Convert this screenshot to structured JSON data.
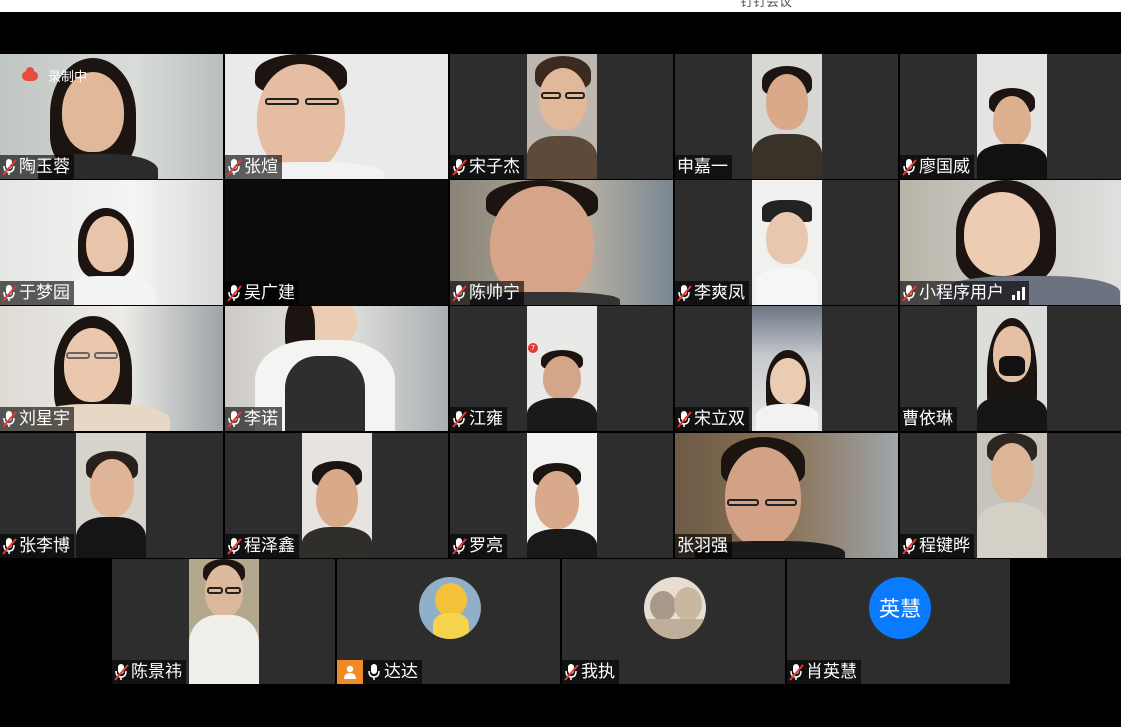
{
  "window": {
    "top_text": "钉钉会议"
  },
  "recording": {
    "label": "录制中"
  },
  "participants": [
    {
      "name": "陶玉蓉",
      "muted": true
    },
    {
      "name": "张煊",
      "muted": true
    },
    {
      "name": "宋子杰",
      "muted": true
    },
    {
      "name": "申嘉一",
      "muted": false
    },
    {
      "name": "廖国威",
      "muted": true
    },
    {
      "name": "于梦园",
      "muted": true
    },
    {
      "name": "吴广建",
      "muted": true
    },
    {
      "name": "陈帅宁",
      "muted": true
    },
    {
      "name": "李爽凤",
      "muted": true
    },
    {
      "name": "小程序用户",
      "muted": true
    },
    {
      "name": "刘星宇",
      "muted": true
    },
    {
      "name": "李诺",
      "muted": true
    },
    {
      "name": "江雍",
      "muted": true
    },
    {
      "name": "宋立双",
      "muted": true
    },
    {
      "name": "曹依琳",
      "muted": false
    },
    {
      "name": "张李博",
      "muted": true
    },
    {
      "name": "程泽鑫",
      "muted": true
    },
    {
      "name": "罗亮",
      "muted": true
    },
    {
      "name": "张羽强",
      "muted": false
    },
    {
      "name": "程键晔",
      "muted": true
    },
    {
      "name": "陈景祎",
      "muted": true
    },
    {
      "name": "达达",
      "muted": false,
      "host": true
    },
    {
      "name": "我执",
      "muted": true
    },
    {
      "name": "肖英慧",
      "muted": true,
      "initials": "英慧"
    }
  ],
  "colors": {
    "avatar_blue": "#0a7bff",
    "host_orange": "#f08a24",
    "tile_bg": "#2d2d2d"
  },
  "notification": {
    "badge": "7"
  }
}
